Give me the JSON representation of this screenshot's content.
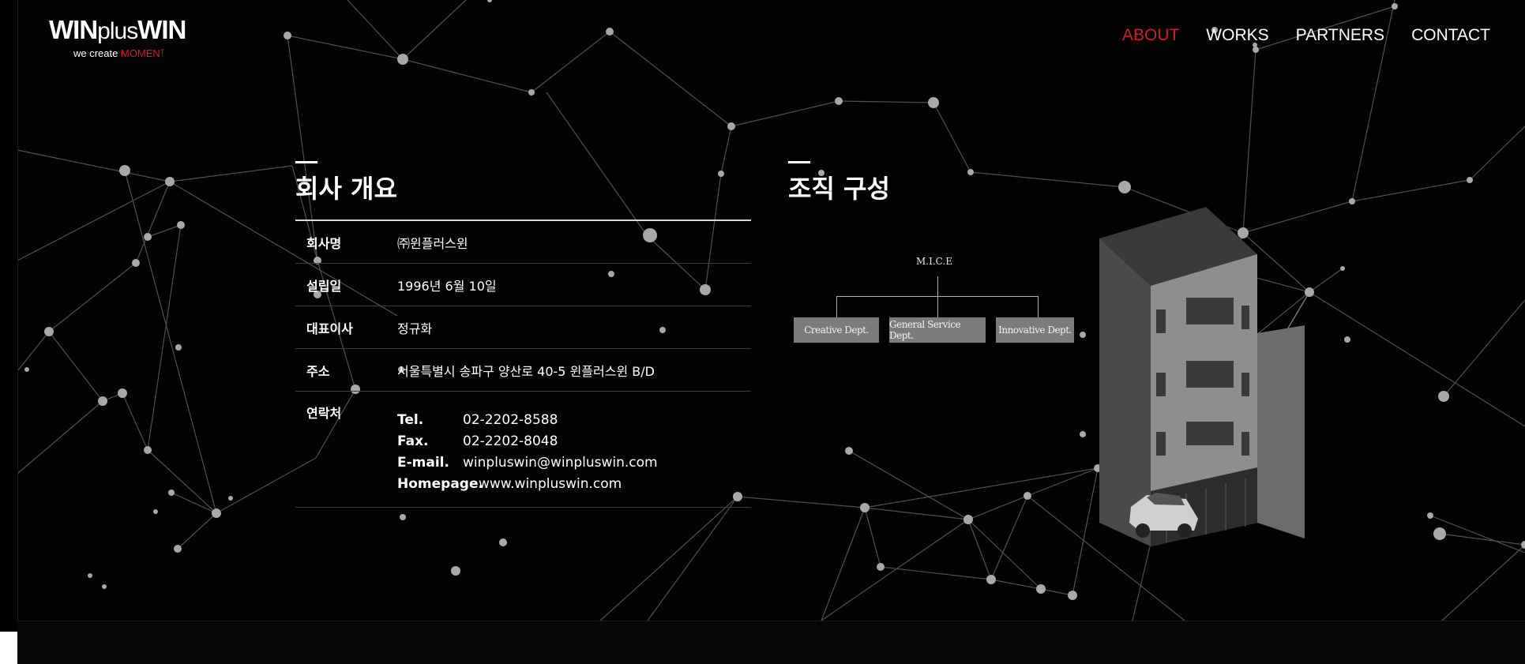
{
  "brand": {
    "logo_main_1": "WIN",
    "logo_main_2": "plus",
    "logo_main_3": "WIN",
    "tagline_prefix": "we create ",
    "tagline_accent": "MOMENᵀ"
  },
  "nav": {
    "items": [
      {
        "label": "ABOUT",
        "active": true
      },
      {
        "label": "WORKS",
        "active": false
      },
      {
        "label": "PARTNERS",
        "active": false
      },
      {
        "label": "CONTACT",
        "active": false
      }
    ]
  },
  "overview": {
    "title": "회사 개요",
    "rows": [
      {
        "label": "회사명",
        "value": "㈜윈플러스윈"
      },
      {
        "label": "설립일",
        "value": "1996년 6월 10일"
      },
      {
        "label": "대표이사",
        "value": "정규화"
      },
      {
        "label": "주소",
        "value": "서울특별시 송파구 양산로 40-5 윈플러스윈 B/D"
      }
    ],
    "contact": {
      "label": "연락처",
      "tel_key": "Tel.",
      "tel": "02-2202-8588",
      "fax_key": "Fax.",
      "fax": "02-2202-8048",
      "email_key": "E-mail.",
      "email": "winpluswin@winpluswin.com",
      "home_key": "Homepage.",
      "home": "www.winpluswin.com"
    }
  },
  "organization": {
    "title": "조직 구성",
    "root": "M.I.C.E",
    "depts": [
      "Creative Dept.",
      "General Service Dept.",
      "Innovative Dept."
    ]
  },
  "colors": {
    "accent": "#d01f2a",
    "background": "#020202",
    "org_box": "#7b7b7b"
  }
}
